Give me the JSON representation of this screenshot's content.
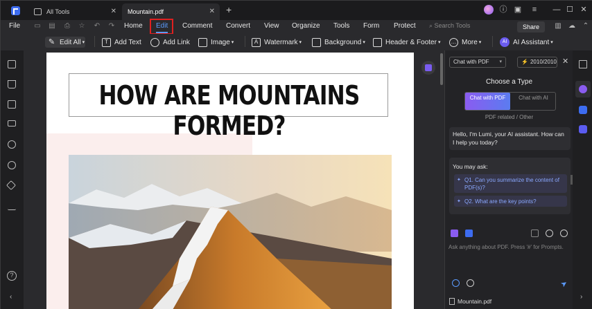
{
  "tabs": [
    {
      "label": "All Tools"
    },
    {
      "label": "Mountain.pdf"
    }
  ],
  "menu": {
    "file": "File",
    "items": [
      "Home",
      "Edit",
      "Comment",
      "Convert",
      "View",
      "Organize",
      "Tools",
      "Form",
      "Protect"
    ],
    "search_placeholder": "Search Tools",
    "share": "Share"
  },
  "toolbar": {
    "edit_all": "Edit All",
    "add_text": "Add Text",
    "add_link": "Add Link",
    "image": "Image",
    "watermark": "Watermark",
    "background": "Background",
    "header_footer": "Header & Footer",
    "more": "More",
    "ai_assistant": "AI Assistant"
  },
  "document": {
    "title": "HOW ARE MOUNTAINS FORMED?"
  },
  "ai_panel": {
    "chat_mode": "Chat with PDF",
    "credits": "2010/2010",
    "choose_type": "Choose a Type",
    "option_pdf": "Chat with PDF",
    "option_ai": "Chat with AI",
    "type_note": "PDF related / Other",
    "greeting": "Hello, I'm Lumi, your AI assistant. How can I help you today?",
    "may_ask": "You may ask:",
    "questions": [
      "Q1. Can you summarize the content of PDF(s)?",
      "Q2. What are the key points?"
    ],
    "input_placeholder": "Ask anything about PDF. Press '#' for Prompts.",
    "file_name": "Mountain.pdf"
  },
  "colors": {
    "accent": "#5b9bff",
    "highlight": "#e02020",
    "ai_gradient_start": "#8a5cf0",
    "ai_gradient_end": "#5b7cf0"
  }
}
